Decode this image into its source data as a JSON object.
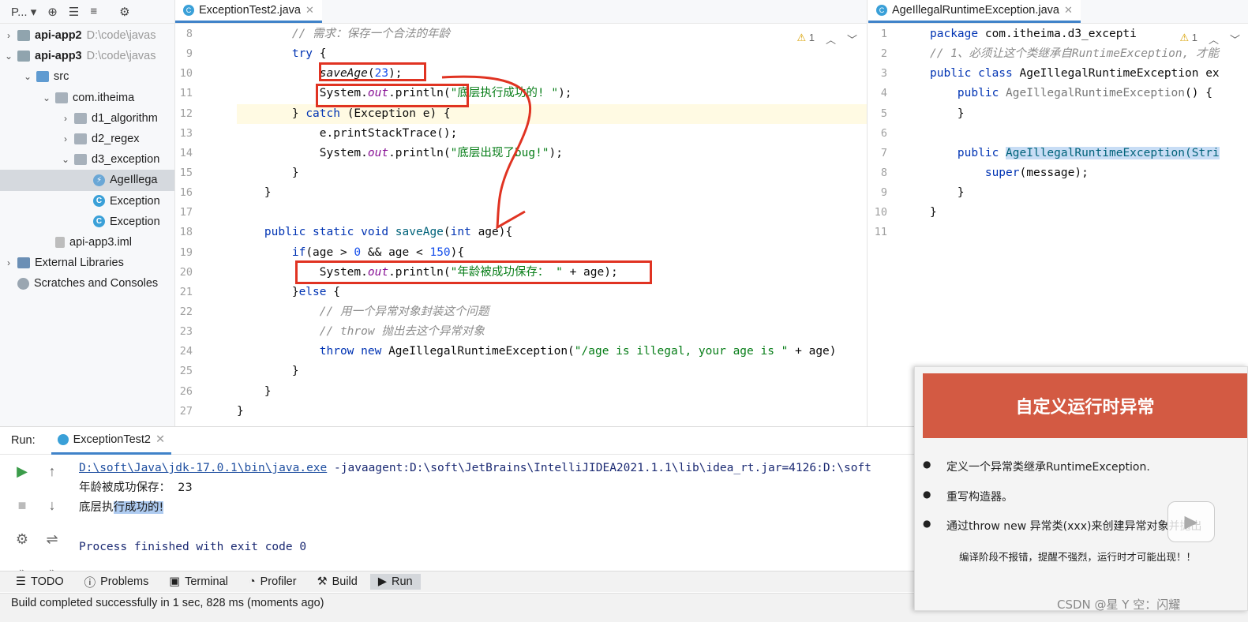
{
  "project": {
    "toolbar_label": "P...",
    "items": [
      {
        "label": "api-app2",
        "path": "D:\\code\\javas",
        "indent": 0,
        "arrow": "›",
        "icon": "module"
      },
      {
        "label": "api-app3",
        "path": "D:\\code\\javas",
        "indent": 0,
        "arrow": "⌄",
        "icon": "module"
      },
      {
        "label": "src",
        "indent": 1,
        "arrow": "⌄",
        "icon": "src"
      },
      {
        "label": "com.itheima",
        "indent": 2,
        "arrow": "⌄",
        "icon": "pkg"
      },
      {
        "label": "d1_algorithm",
        "indent": 3,
        "arrow": "›",
        "icon": "pkg"
      },
      {
        "label": "d2_regex",
        "indent": 3,
        "arrow": "›",
        "icon": "pkg"
      },
      {
        "label": "d3_exception",
        "indent": 3,
        "arrow": "⌄",
        "icon": "pkg"
      },
      {
        "label": "AgeIllega",
        "indent": 4,
        "arrow": "",
        "icon": "exc",
        "selected": true
      },
      {
        "label": "Exception",
        "indent": 4,
        "arrow": "",
        "icon": "cls"
      },
      {
        "label": "Exception",
        "indent": 4,
        "arrow": "",
        "icon": "cls"
      },
      {
        "label": "api-app3.iml",
        "indent": 2,
        "arrow": "",
        "icon": "file"
      },
      {
        "label": "External Libraries",
        "indent": 0,
        "arrow": "›",
        "icon": "lib"
      },
      {
        "label": "Scratches and Consoles",
        "indent": 0,
        "arrow": "",
        "icon": "scr"
      }
    ]
  },
  "editor1": {
    "tab_label": "ExceptionTest2.java",
    "warning_count": "1",
    "line_numbers": [
      "8",
      "9",
      "10",
      "11",
      "12",
      "13",
      "14",
      "15",
      "16",
      "17",
      "18",
      "19",
      "20",
      "21",
      "22",
      "23",
      "24",
      "25",
      "26",
      "27"
    ]
  },
  "editor2": {
    "tab_label": "AgeIllegalRuntimeException.java",
    "warning_count": "1",
    "line_numbers": [
      "1",
      "2",
      "3",
      "4",
      "5",
      "6",
      "7",
      "8",
      "9",
      "10",
      "11"
    ]
  },
  "run": {
    "label": "Run:",
    "tab_label": "ExceptionTest2",
    "console": {
      "java_path": "D:\\soft\\Java\\jdk-17.0.1\\bin\\java.exe",
      "java_args": " -javaagent:D:\\soft\\JetBrains\\IntelliJIDEA2021.1.1\\lib\\idea_rt.jar=4126:D:\\soft",
      "line2": "年龄被成功保存：  23",
      "line3_a": "底层执",
      "line3_b": "行成功的!",
      "line5": "Process finished with exit code 0"
    }
  },
  "bottom": {
    "items": [
      "TODO",
      "Problems",
      "Terminal",
      "Profiler",
      "Build",
      "Run"
    ]
  },
  "status": {
    "text": "Build completed successfully in 1 sec, 828 ms (moments ago)"
  },
  "slide": {
    "title": "自定义运行时异常",
    "bullets": [
      "定义一个异常类继承RuntimeException.",
      "重写构造器。",
      "通过throw new 异常类(xxx)来创建异常对象并抛出"
    ],
    "note": "编译阶段不报错，提醒不强烈，运行时才可能出现！！",
    "watermark": "CSDN @星 Y 空：闪耀"
  },
  "colors": {
    "accent": "#4083c9",
    "annotation_red": "#e03322",
    "slide_header": "#d35a43"
  }
}
